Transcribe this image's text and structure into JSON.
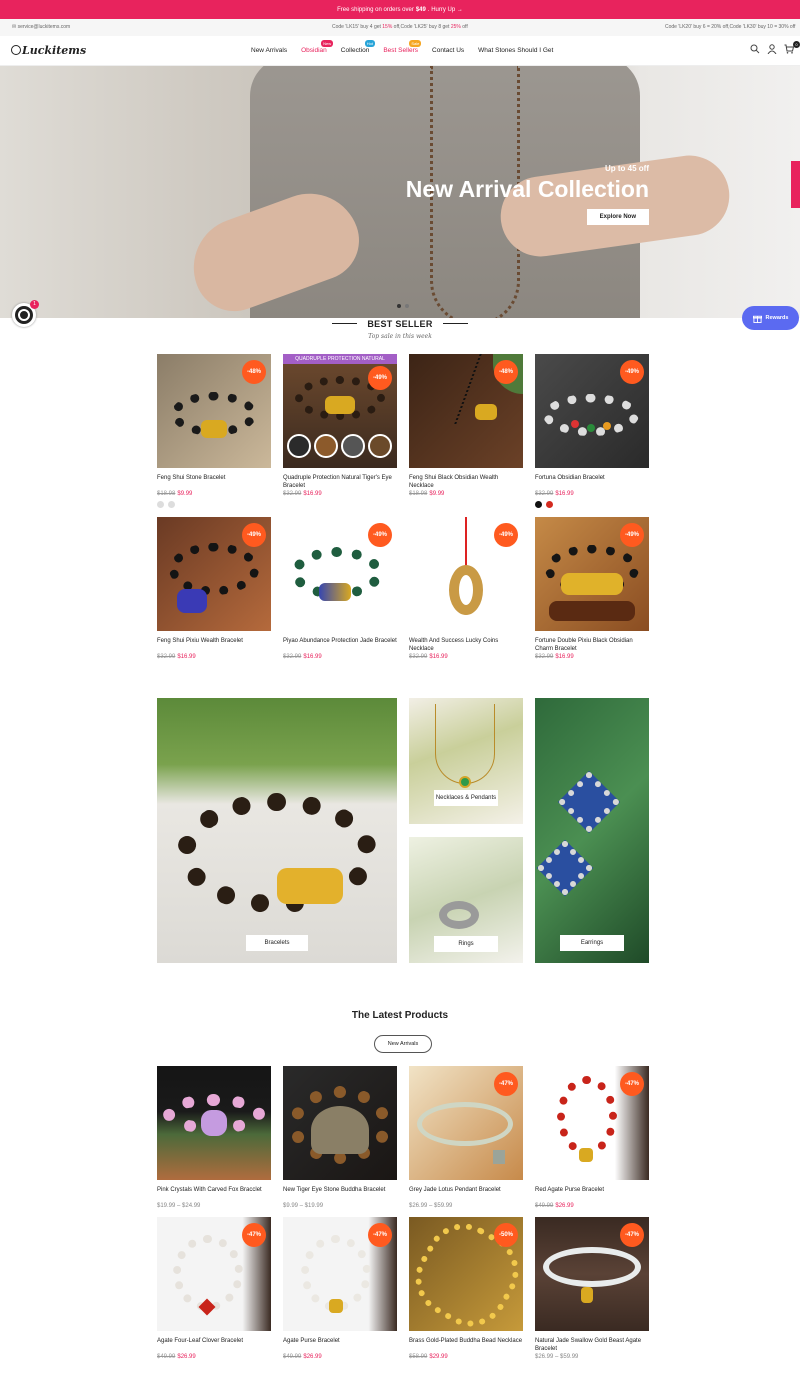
{
  "topbar": {
    "text_pre": "Free shipping on orders over",
    "amount": "$49",
    "text_post": ". Hurry Up →"
  },
  "infobar": {
    "email": "✉ service@luckitems.com",
    "codes": [
      {
        "text": "Code 'LK15' buy 4 get ",
        "hl": "15%",
        "post": " off,"
      },
      {
        "text": "Code 'LK25' buy 8 get ",
        "hl": "25%",
        "post": " off"
      }
    ],
    "codes_right": "Code 'LK20' buy 6 = 20% off,Code 'LK30' buy 10 = 30% off"
  },
  "header": {
    "logo": "Luckitems",
    "nav": [
      {
        "label": "New Arrivals",
        "badge": ""
      },
      {
        "label": "Obsidian",
        "badge": "New",
        "badge_color": "#e8235d"
      },
      {
        "label": "Collection",
        "badge": "Hot",
        "badge_color": "#27a4d8"
      },
      {
        "label": "Best Sellers",
        "badge": "Sale",
        "badge_color": "#f5a623"
      },
      {
        "label": "Contact Us",
        "badge": ""
      },
      {
        "label": "What Stones Should I Get",
        "badge": ""
      }
    ],
    "cart_count": "0"
  },
  "hero": {
    "subtitle": "Up to 45 off",
    "title": "New Arrival Collection",
    "button": "Explore Now"
  },
  "widgets": {
    "chat_badge": "1",
    "rewards": "Rewards"
  },
  "best_seller": {
    "title": "BEST SELLER",
    "subtitle": "Top sale in this week",
    "products": [
      {
        "name": "Feng Shui Stone Bracelet",
        "old": "$18.98",
        "new": "$9.99",
        "discount": "-48%"
      },
      {
        "name": "Quadruple Protection Natural Tiger's Eye Bracelet",
        "old": "$32.99",
        "new": "$16.99",
        "discount": "-49%"
      },
      {
        "name": "Feng Shui Black Obsidian Wealth Necklace",
        "old": "$18.98",
        "new": "$9.99",
        "discount": "-48%"
      },
      {
        "name": "Fortuna Obsidian Bracelet",
        "old": "$32.99",
        "new": "$16.99",
        "discount": "-49%"
      },
      {
        "name": "Feng Shui Pixiu Wealth Bracelet",
        "old": "$32.99",
        "new": "$16.99",
        "discount": "-49%"
      },
      {
        "name": "Piyao Abundance Protection Jade Bracelet",
        "old": "$32.99",
        "new": "$16.99",
        "discount": "-49%"
      },
      {
        "name": "Wealth And Success Lucky Coins Necklace",
        "old": "$32.99",
        "new": "$16.99",
        "discount": "-49%"
      },
      {
        "name": "Fortune Double Pixiu Black Obsidian Charm Bracelet",
        "old": "$32.99",
        "new": "$16.99",
        "discount": "-49%"
      }
    ],
    "product_2_banner": "QUADRUPLE PROTECTION NATURAL"
  },
  "collections": {
    "bracelets": "Bracelets",
    "necklaces": "Necklaces & Pendants",
    "rings": "Rings",
    "earrings": "Earrings"
  },
  "latest": {
    "title": "The Latest Products",
    "button": "New Arrivals",
    "products": [
      {
        "name": "Pink Crystals With Carved Fox Bracclet",
        "range": "$19.99 – $24.99",
        "discount": ""
      },
      {
        "name": "New Tiger Eye Stone Buddha Bracelet",
        "range": "$9.99 – $19.99",
        "discount": ""
      },
      {
        "name": "Grey Jade Lotus Pendant Bracelet",
        "range": "$26.99 – $59.99",
        "discount": "-47%"
      },
      {
        "name": "Red Agate Purse Bracelet",
        "old": "$49.99",
        "new": "$26.99",
        "discount": "-47%"
      },
      {
        "name": "Agate Four-Leaf Clover Bracelet",
        "old": "$49.99",
        "new": "$26.99",
        "discount": "-47%"
      },
      {
        "name": "Agate Purse Bracelet",
        "old": "$49.99",
        "new": "$26.99",
        "discount": "-47%"
      },
      {
        "name": "Brass Gold-Plated Buddha Bead Necklace",
        "old": "$58.99",
        "new": "$29.99",
        "discount": "-50%"
      },
      {
        "name": "Natural Jade Swallow Gold Beast Agate Bracelet",
        "range": "$26.99 – $59.99",
        "discount": "-47%"
      }
    ]
  }
}
